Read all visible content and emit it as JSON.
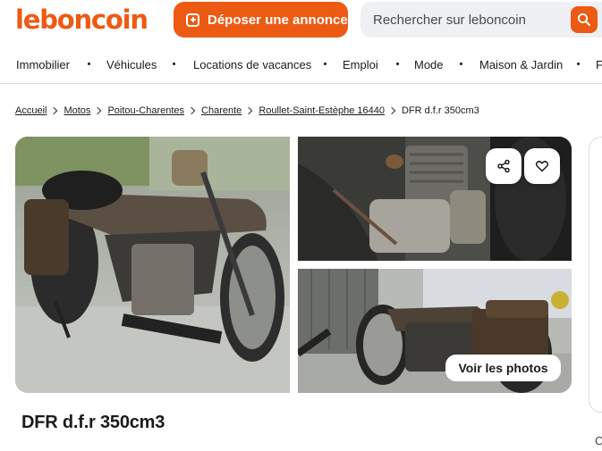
{
  "header": {
    "logo": "leboncoin",
    "deposit_label": "Déposer une annonce",
    "search_placeholder": "Rechercher sur leboncoin"
  },
  "nav": {
    "items": [
      "Immobilier",
      "Véhicules",
      "Locations de vacances",
      "Emploi",
      "Mode",
      "Maison & Jardin",
      "F"
    ]
  },
  "breadcrumb": {
    "links": [
      "Accueil",
      "Motos",
      "Poitou-Charentes",
      "Charente",
      "Roullet-Saint-Estèphe 16440"
    ],
    "current": "DFR d.f.r 350cm3"
  },
  "gallery": {
    "photos_button": "Voir les photos",
    "icons": {
      "share": "share-icon",
      "favorite": "heart-icon",
      "search": "search-icon"
    }
  },
  "listing": {
    "title": "DFR d.f.r 350cm3"
  },
  "side_panel": {
    "visible_letter": "C"
  },
  "colors": {
    "brand": "#ec5a13",
    "text": "#1a1a1a",
    "search_bg": "#eef0f4",
    "divider": "#d7dce3"
  }
}
